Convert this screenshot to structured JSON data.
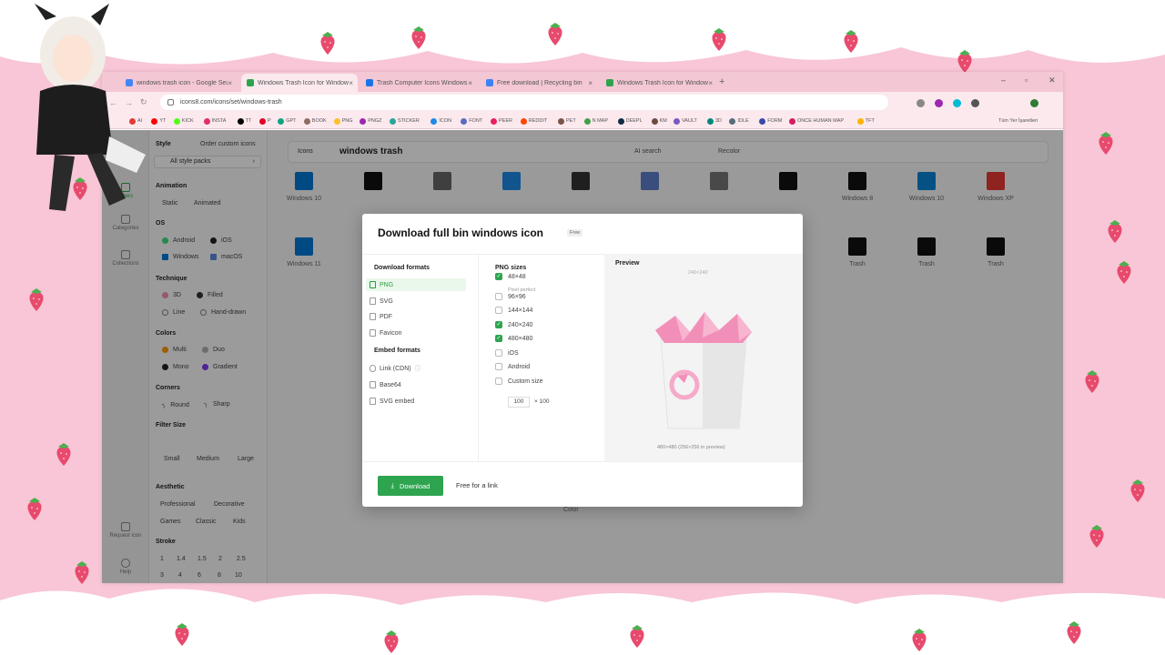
{
  "browser": {
    "tabs": [
      {
        "label": "windows trash icon - Google Search",
        "fav": "#4285f4"
      },
      {
        "label": "Windows Trash Icon for Windows",
        "fav": "#2ea44f"
      },
      {
        "label": "Trash Computer Icons Windows",
        "fav": "#1a73e8"
      },
      {
        "label": "Free download | Recycling bin",
        "fav": "#3b82f6"
      },
      {
        "label": "Windows Trash Icon for Windows",
        "fav": "#2ea44f"
      }
    ],
    "url": "icons8.com/icons/set/windows-trash",
    "bookmarks": [
      "AI",
      "YT",
      "KICK",
      "INSTA",
      "TT",
      "P",
      "GPT",
      "BOOK",
      "PNG",
      "PNGZ",
      "STICKER",
      "ICON",
      "FONT",
      "PEER",
      "REDDIT",
      "PET",
      "N MAP",
      "DEEPL",
      "KM",
      "VAULT",
      "3D",
      "IDLE",
      "FORM",
      "ONCE HUMAN MAP",
      "TFT"
    ],
    "bookmarks_right": "Tüm Yer İşaretleri"
  },
  "rail": {
    "filters": "Filters",
    "categories": "Categories",
    "collections": "Collections",
    "request": "Request icon",
    "help": "Help"
  },
  "filters": {
    "style": "Style",
    "order_custom": "Order custom icons",
    "all_style_packs": "All style packs",
    "animation": "Animation",
    "static": "Static",
    "animated": "Animated",
    "os": "OS",
    "android": "Android",
    "ios": "iOS",
    "windows": "Windows",
    "macos": "macOS",
    "technique": "Technique",
    "t3d": "3D",
    "filled": "Filled",
    "line": "Line",
    "handdrawn": "Hand-drawn",
    "colors": "Colors",
    "multi": "Multi",
    "duo": "Duo",
    "mono": "Mono",
    "gradient": "Gradient",
    "corners": "Corners",
    "round": "Round",
    "sharp": "Sharp",
    "filter_size": "Filter Size",
    "small": "Small",
    "medium": "Medium",
    "large": "Large",
    "aesthetic": "Aesthetic",
    "professional": "Professional",
    "decorative": "Decorative",
    "games": "Games",
    "classic": "Classic",
    "kids": "Kids",
    "stroke": "Stroke",
    "strokes1": [
      "1",
      "1.4",
      "1.5",
      "2",
      "2.5"
    ],
    "strokes2": [
      "3",
      "4",
      "6",
      "8",
      "10"
    ]
  },
  "search": {
    "type": "Icons",
    "query": "windows trash",
    "ai_search": "AI search",
    "recolor": "Recolor"
  },
  "grid": {
    "row1": [
      "Windows 10",
      "",
      "",
      "",
      "",
      "",
      "",
      "",
      "Windows 8",
      "Windows 10",
      "Windows XP"
    ],
    "row2": [
      "Windows 11",
      "",
      "",
      "",
      "",
      "",
      "",
      "Trash",
      "Trash",
      "Trash",
      "Trash"
    ],
    "color_label": "Color"
  },
  "modal": {
    "title": "Download full bin windows icon",
    "badge": "Free",
    "download_formats": "Download formats",
    "formats": [
      "PNG",
      "SVG",
      "PDF",
      "Favicon"
    ],
    "embed_formats": "Embed formats",
    "embeds": [
      "Link (CDN)",
      "Base64",
      "SVG embed"
    ],
    "png_sizes": "PNG sizes",
    "sizes": [
      {
        "label": "48×48",
        "on": true
      },
      {
        "label": "96×96",
        "on": false
      },
      {
        "label": "144×144",
        "on": false
      },
      {
        "label": "240×240",
        "on": true
      },
      {
        "label": "480×480",
        "on": true
      },
      {
        "label": "iOS",
        "on": false
      },
      {
        "label": "Android",
        "on": false
      },
      {
        "label": "Custom size",
        "on": false
      }
    ],
    "pixel_perfect": "Pixel perfect",
    "custom_w": "100",
    "custom_x": "× 100",
    "preview": "Preview",
    "preview_top_caption": "240×240",
    "preview_caption": "480×480 (256×256 in preview)",
    "download": "Download",
    "free_link": "Free for a link"
  },
  "colors": {
    "accent": "#2ea44f",
    "bin_pink": "#f28fb8",
    "bin_white": "#f3f3f3"
  }
}
